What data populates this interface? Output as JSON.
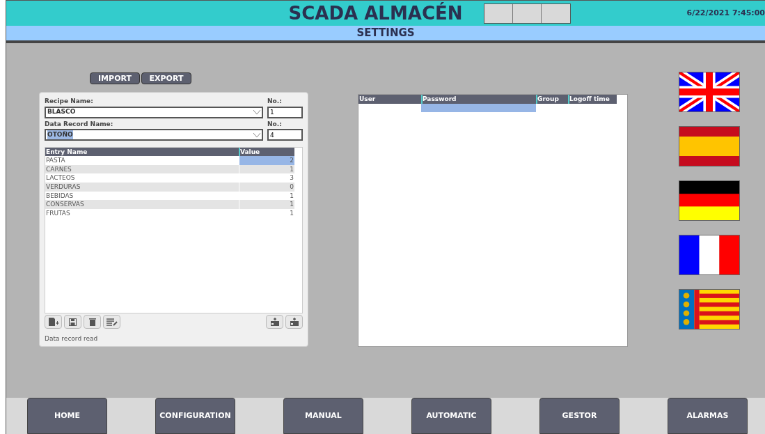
{
  "header": {
    "title": "SCADA ALMACÉN",
    "datetime": "6/22/2021 7:45:00",
    "subtitle": "SETTINGS"
  },
  "file_buttons": [
    "IMPORT",
    "EXPORT"
  ],
  "recipe": {
    "recipe_label": "Recipe Name:",
    "recipe_value": "BLASCO",
    "recipe_no_label": "No.:",
    "recipe_no": "1",
    "record_label": "Data Record Name:",
    "record_value": "OTOÑO",
    "record_no_label": "No.:",
    "record_no": "4",
    "columns": [
      "Entry Name",
      "Value"
    ],
    "rows": [
      {
        "name": "PASTA",
        "value": "2",
        "selected": true
      },
      {
        "name": "CARNES",
        "value": "1",
        "selected": false
      },
      {
        "name": "LACTEOS",
        "value": "3",
        "selected": false
      },
      {
        "name": "VERDURAS",
        "value": "0",
        "selected": false
      },
      {
        "name": "BEBIDAS",
        "value": "1",
        "selected": false
      },
      {
        "name": "CONSERVAS",
        "value": "1",
        "selected": false
      },
      {
        "name": "FRUTAS",
        "value": "1",
        "selected": false
      }
    ],
    "status": "Data record read"
  },
  "users_table": {
    "columns": [
      "User",
      "Password",
      "Group",
      "Logoff time"
    ]
  },
  "nav": [
    {
      "label": "HOME"
    },
    {
      "label": "CONFIGURATION"
    },
    {
      "label": "MANUAL"
    },
    {
      "label": "AUTOMATIC"
    },
    {
      "label": "GESTOR"
    },
    {
      "label": "ALARMAS"
    }
  ]
}
